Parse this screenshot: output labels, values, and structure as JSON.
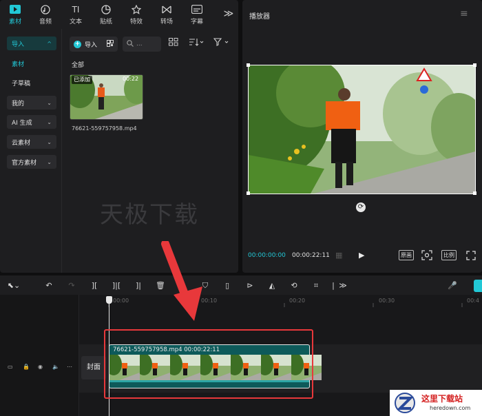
{
  "colors": {
    "accent": "#22c8d6",
    "annotation": "#e8383b",
    "clip": "#0d5a5a"
  },
  "top_tabs": [
    {
      "icon": "media-icon",
      "label": "素材"
    },
    {
      "icon": "audio-icon",
      "label": "音频"
    },
    {
      "icon": "text-icon",
      "label": "文本"
    },
    {
      "icon": "sticker-icon",
      "label": "贴纸"
    },
    {
      "icon": "effects-icon",
      "label": "特效"
    },
    {
      "icon": "transition-icon",
      "label": "转场"
    },
    {
      "icon": "subtitle-icon",
      "label": "字幕"
    }
  ],
  "text_icon_glyph": "TI",
  "more_glyph": "≫",
  "sidebar": {
    "import": "导入",
    "material": "素材",
    "draft": "子草稿",
    "mine": "我的",
    "ai": "AI 生成",
    "cloud": "云素材",
    "official": "官方素材"
  },
  "media": {
    "import_button": "导入",
    "search_placeholder": "...",
    "all_label": "全部",
    "badge": "已添加",
    "thumb_duration": "00:22",
    "file_name": "76621-559757958.mp4",
    "watermark": "天极下载"
  },
  "player": {
    "title": "播放器",
    "time_current": "00:00:00:00",
    "time_total": "00:00:22:11",
    "btn_original": "原画",
    "btn_ratio": "比例"
  },
  "timeline": {
    "ticks": [
      "00:00",
      "00:10",
      "00:20",
      "00:30",
      "00:4"
    ],
    "cover": "封面",
    "clip_label": "76621-559757958.mp4   00:00:22:11"
  },
  "logo": {
    "text": "这里下载站",
    "sub": "heredown.com"
  }
}
